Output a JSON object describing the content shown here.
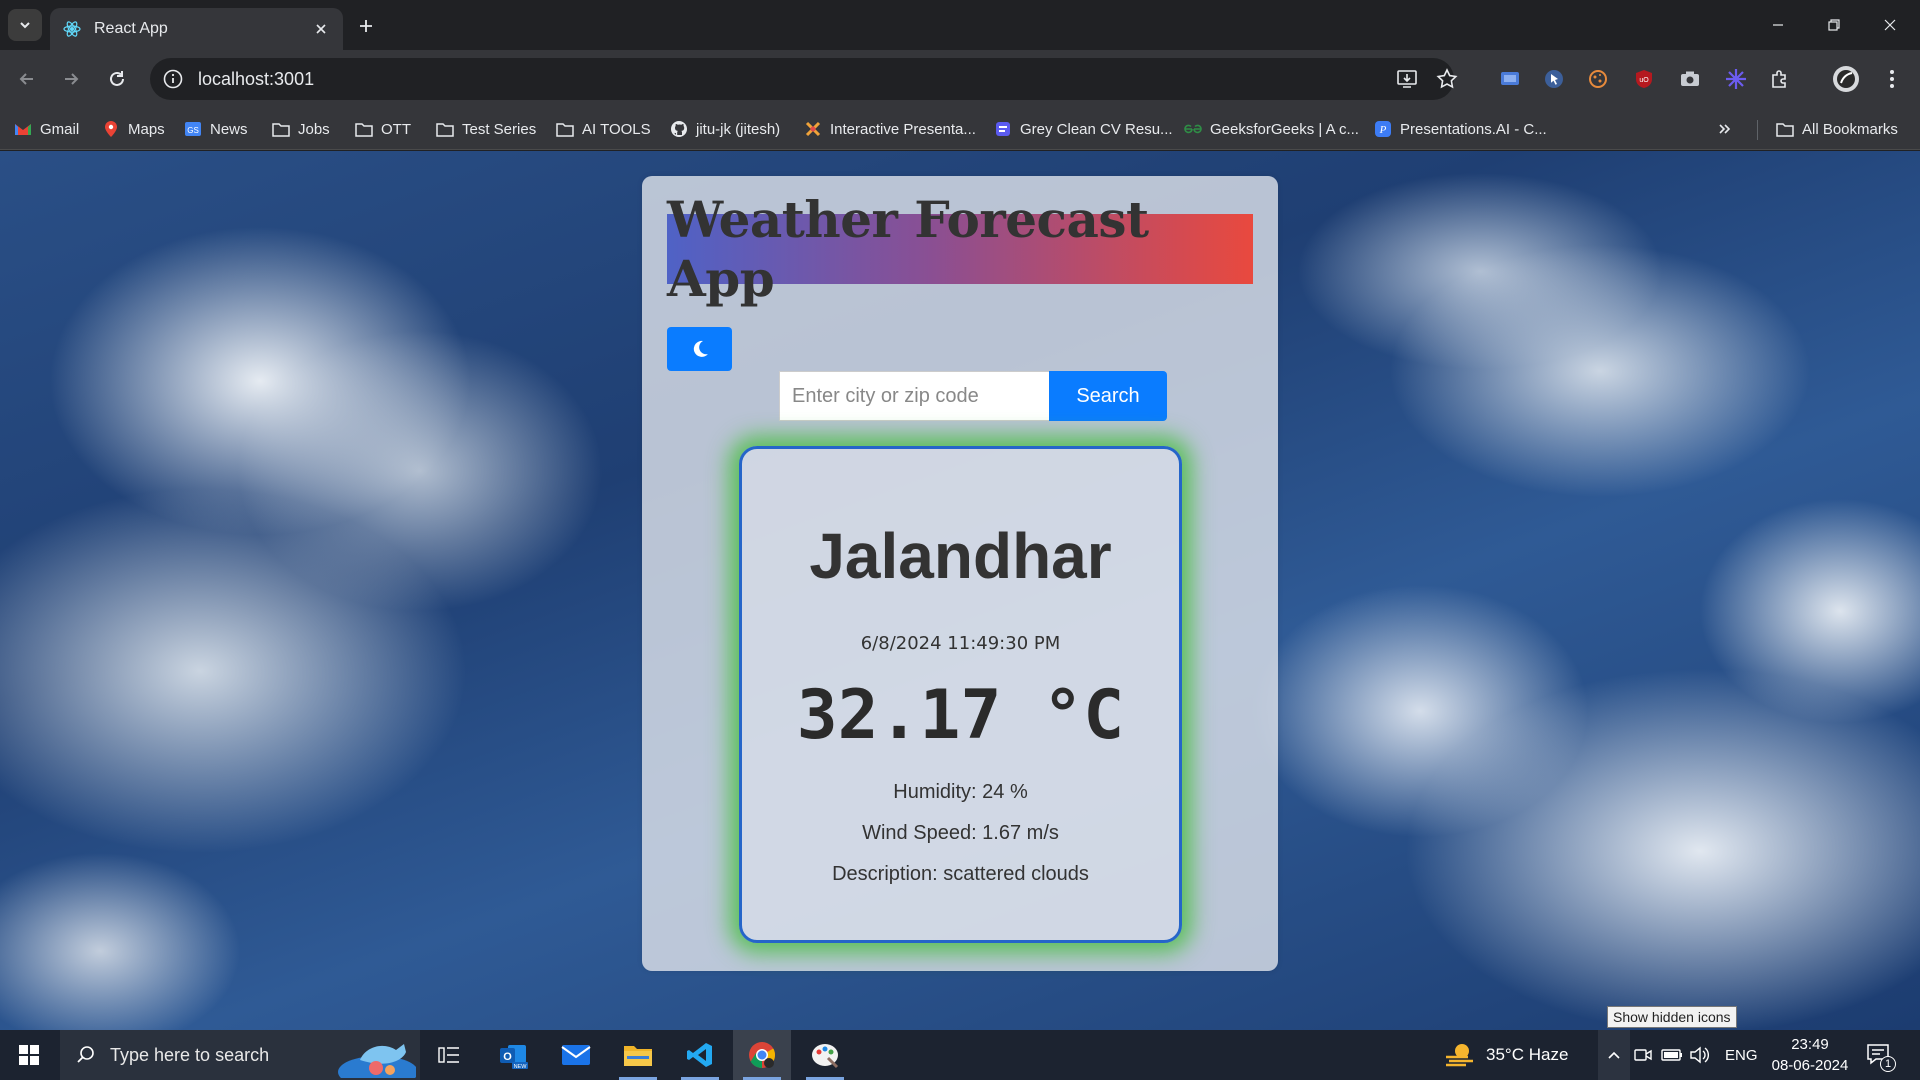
{
  "browser": {
    "tab_title": "React App",
    "url": "localhost:3001",
    "bookmarks": [
      {
        "label": "Gmail",
        "icon": "gmail-icon"
      },
      {
        "label": "Maps",
        "icon": "maps-icon"
      },
      {
        "label": "News",
        "icon": "news-icon"
      },
      {
        "label": "Jobs",
        "icon": "folder-icon"
      },
      {
        "label": "OTT",
        "icon": "folder-icon"
      },
      {
        "label": "Test Series",
        "icon": "folder-icon"
      },
      {
        "label": "AI TOOLS",
        "icon": "folder-icon"
      },
      {
        "label": "jitu-jk (jitesh)",
        "icon": "github-icon"
      },
      {
        "label": "Interactive Presenta...",
        "icon": "presentation-icon"
      },
      {
        "label": "Grey Clean CV Resu...",
        "icon": "canva-icon"
      },
      {
        "label": "GeeksforGeeks | A c...",
        "icon": "gfg-icon"
      },
      {
        "label": "Presentations.AI - C...",
        "icon": "presentations-ai-icon"
      }
    ],
    "all_bookmarks": "All Bookmarks"
  },
  "app": {
    "title": "Weather Forecast App",
    "search_placeholder": "Enter city or zip code",
    "search_button": "Search",
    "weather": {
      "city": "Jalandhar",
      "datetime": "6/8/2024 11:49:30 PM",
      "temperature": "32.17 °C",
      "humidity": "Humidity: 24 %",
      "wind_speed": "Wind Speed: 1.67 m/s",
      "description": "Description: scattered clouds"
    },
    "colors": {
      "accent": "#0a7cff",
      "title_gradient": [
        "#4f62c6",
        "#8a4f93",
        "#e9493e"
      ],
      "card_border": "#2565c9",
      "card_glow": "#3cbe32"
    }
  },
  "taskbar": {
    "search_placeholder": "Type here to search",
    "weather": "35°C  Haze",
    "language": "ENG",
    "time": "23:49",
    "date": "08-06-2024",
    "notification_count": "1",
    "tooltip": "Show hidden icons"
  }
}
